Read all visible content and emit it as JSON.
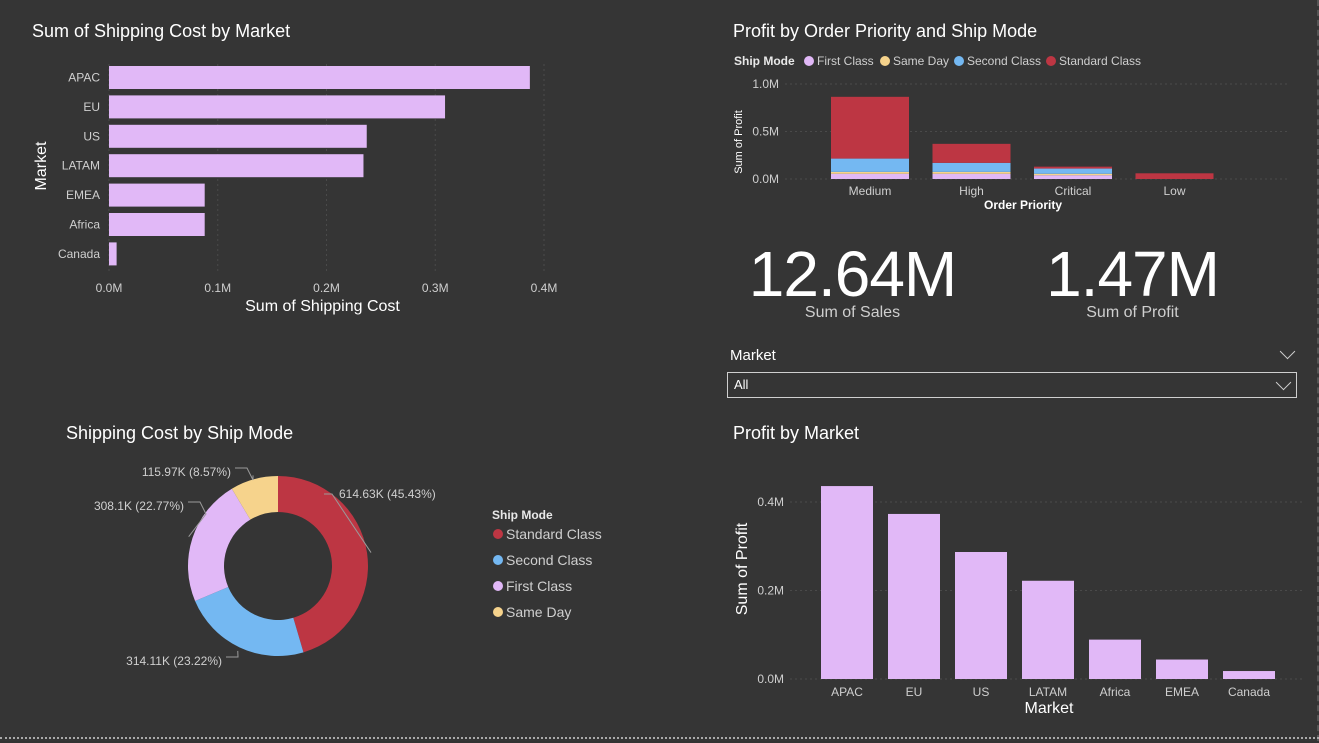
{
  "colors": {
    "first_class": "#e1b8f7",
    "same_day": "#f6d38c",
    "second_class": "#74b8f2",
    "standard_class": "#bd3643",
    "background": "#353535",
    "text": "#ffffff",
    "subtext": "#cfcfcf"
  },
  "shipping_by_market": {
    "title": "Sum of Shipping Cost by Market",
    "chart_data": {
      "type": "bar",
      "orientation": "horizontal",
      "categories": [
        "APAC",
        "EU",
        "US",
        "LATAM",
        "EMEA",
        "Africa",
        "Canada"
      ],
      "values": [
        387000,
        309000,
        237000,
        234000,
        88000,
        88000,
        7000
      ],
      "xlabel": "Sum of Shipping Cost",
      "ylabel": "Market",
      "xlim": [
        0,
        400000
      ],
      "ticks": [
        "0.0M",
        "0.1M",
        "0.2M",
        "0.3M",
        "0.4M"
      ],
      "grid": true
    }
  },
  "profit_priority": {
    "title": "Profit by Order Priority and Ship Mode",
    "legend_title": "Ship Mode",
    "chart_data": {
      "type": "bar",
      "stacked": true,
      "categories": [
        "Medium",
        "High",
        "Critical",
        "Low"
      ],
      "series": [
        {
          "name": "First Class",
          "values": [
            55000,
            55000,
            40000,
            0
          ]
        },
        {
          "name": "Same Day",
          "values": [
            20000,
            20000,
            15000,
            0
          ]
        },
        {
          "name": "Second Class",
          "values": [
            140000,
            95000,
            55000,
            0
          ]
        },
        {
          "name": "Standard Class",
          "values": [
            650000,
            200000,
            20000,
            60000
          ]
        }
      ],
      "xlabel": "Order Priority",
      "ylabel": "Sum of Profit",
      "ylim": [
        0,
        1000000
      ],
      "ticks": [
        "0.0M",
        "0.5M",
        "1.0M"
      ],
      "legend_position": "top-left"
    }
  },
  "kpis": {
    "sales": {
      "value": "12.64M",
      "label": "Sum of Sales"
    },
    "profit": {
      "value": "1.47M",
      "label": "Sum of Profit"
    }
  },
  "slicer": {
    "title": "Market",
    "selected": "All"
  },
  "shipping_by_mode": {
    "title": "Shipping Cost by Ship Mode",
    "legend_title": "Ship Mode",
    "chart_data": {
      "type": "pie",
      "donut": true,
      "categories": [
        "Standard Class",
        "Second Class",
        "First Class",
        "Same Day"
      ],
      "values": [
        614630,
        314110,
        308100,
        115970
      ],
      "labels": [
        "614.63K (45.43%)",
        "314.11K (23.22%)",
        "308.1K (22.77%)",
        "115.97K (8.57%)"
      ],
      "legend_position": "right"
    }
  },
  "profit_by_market": {
    "title": "Profit by Market",
    "chart_data": {
      "type": "bar",
      "categories": [
        "APAC",
        "EU",
        "US",
        "LATAM",
        "Africa",
        "EMEA",
        "Canada"
      ],
      "values": [
        436000,
        373000,
        287000,
        222000,
        89000,
        44000,
        18000
      ],
      "xlabel": "Market",
      "ylabel": "Sum of Profit",
      "ylim": [
        0,
        450000
      ],
      "ticks": [
        "0.0M",
        "0.2M",
        "0.4M"
      ],
      "grid": true
    }
  }
}
